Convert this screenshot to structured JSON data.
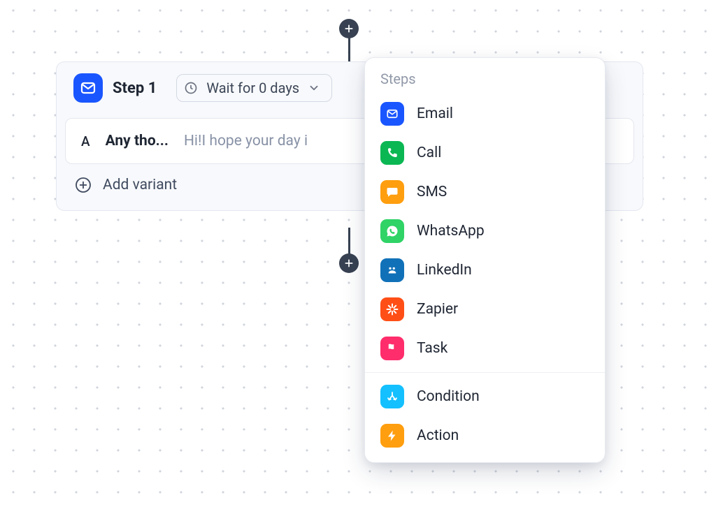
{
  "step": {
    "title": "Step 1",
    "wait_text": "Wait for 0 days",
    "variant": {
      "letter": "A",
      "subject": "Any tho...",
      "preview": "Hi!I hope your day i"
    },
    "add_variant_label": "Add variant"
  },
  "popover": {
    "title": "Steps",
    "items_a": [
      {
        "label": "Email"
      },
      {
        "label": "Call"
      },
      {
        "label": "SMS"
      },
      {
        "label": "WhatsApp"
      },
      {
        "label": "LinkedIn"
      },
      {
        "label": "Zapier"
      },
      {
        "label": "Task"
      }
    ],
    "items_b": [
      {
        "label": "Condition"
      },
      {
        "label": "Action"
      }
    ]
  }
}
